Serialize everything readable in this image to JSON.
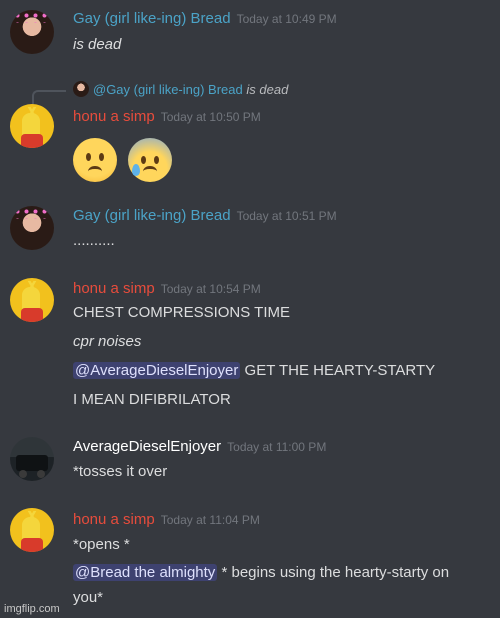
{
  "messages": [
    {
      "author": "Gay (girl like-ing) Bread",
      "author_color": "#4ba3c7",
      "time": "Today at 10:49 PM",
      "lines": [
        "is dead"
      ]
    },
    {
      "reply_to": {
        "mention": "@Gay (girl like-ing) Bread",
        "text": "is dead"
      },
      "author": "honu a simp",
      "author_color": "#e74c3c",
      "time": "Today at 10:50 PM",
      "emojis": [
        "worried-face",
        "anxious-face-with-sweat"
      ]
    },
    {
      "author": "Gay (girl like-ing) Bread",
      "author_color": "#4ba3c7",
      "time": "Today at 10:51 PM",
      "lines": [
        ".........."
      ]
    },
    {
      "author": "honu a simp",
      "author_color": "#e74c3c",
      "time": "Today at 10:54 PM",
      "lines": [
        "CHEST COMPRESSIONS TIME",
        "cpr noises"
      ],
      "mention_line": {
        "mention": "@AverageDieselEnjoyer",
        "text": "GET THE HEARTY-STARTY"
      },
      "last_line": "I MEAN DIFIBRILATOR"
    },
    {
      "author": "AverageDieselEnjoyer",
      "author_color": "#ffffff",
      "time": "Today at 11:00 PM",
      "lines": [
        "*tosses it over"
      ]
    },
    {
      "author": "honu a simp",
      "author_color": "#e74c3c",
      "time": "Today at 11:04 PM",
      "lines": [
        "*opens *"
      ],
      "mention_line": {
        "mention": "@Bread the almighty",
        "text": "* begins using the hearty-starty on"
      },
      "last_line": "you*"
    }
  ],
  "watermark": "imgflip.com",
  "colors": {
    "background": "#36393f",
    "mention_bg": "#3e4270",
    "timestamp": "#72767d"
  }
}
